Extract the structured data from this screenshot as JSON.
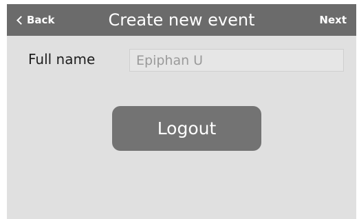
{
  "header": {
    "back_label": "Back",
    "title": "Create new event",
    "next_label": "Next"
  },
  "form": {
    "full_name_label": "Full name",
    "full_name_value": "Epiphan U"
  },
  "actions": {
    "logout_label": "Logout"
  }
}
